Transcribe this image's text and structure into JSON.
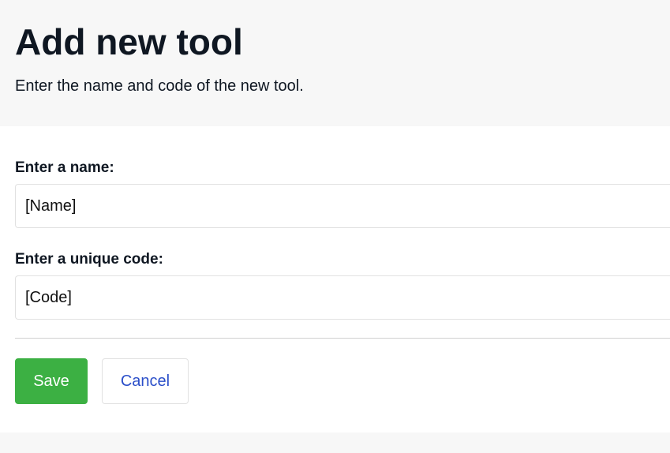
{
  "header": {
    "title": "Add new tool",
    "subtitle": "Enter the name and code of the new tool."
  },
  "form": {
    "name_label": "Enter a name:",
    "name_placeholder": "[Name]",
    "code_label": "Enter a unique code:",
    "code_placeholder": "[Code]"
  },
  "actions": {
    "save_label": "Save",
    "cancel_label": "Cancel"
  },
  "colors": {
    "page_background": "#f7f7f7",
    "panel_background": "#ffffff",
    "save_button": "#3cb043",
    "cancel_text": "#2b4fc9"
  }
}
